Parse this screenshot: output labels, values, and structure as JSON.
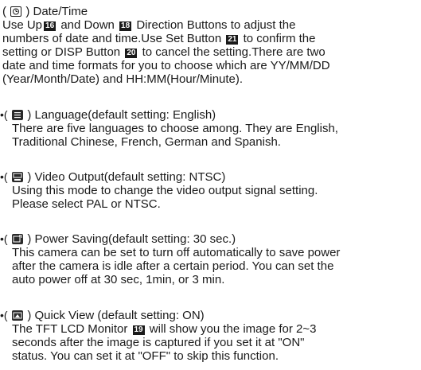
{
  "date_time": {
    "heading": ") Date/Time",
    "lines": [
      [
        "Use Up",
        "16",
        " and Down ",
        "18",
        " Direction Buttons to adjust the"
      ],
      [
        "numbers of date and time.Use Set Button ",
        "21",
        "  to confirm the"
      ],
      [
        "setting or DISP Button ",
        "20",
        " to cancel the setting.There are two"
      ],
      [
        "date and time formats for you to choose which are YY/MM/DD"
      ],
      [
        "(Year/Month/Date) and HH:MM(Hour/Minute)."
      ]
    ]
  },
  "language": {
    "heading": ") Language(default setting: English)",
    "lines": [
      "There are five languages to choose among. They are English,",
      "Traditional Chinese, French, German and  Spanish."
    ]
  },
  "video_output": {
    "heading": ") Video Output(default setting: NTSC)",
    "lines": [
      "Using this mode to change the video output signal setting.",
      "Please select PAL or NTSC."
    ]
  },
  "power_saving": {
    "heading": ") Power Saving(default setting: 30 sec.)",
    "lines": [
      "This camera can be set to turn off automatically to save power",
      "after the camera is idle after a certain period. You can set the",
      "auto power off at 30 sec, 1min, or 3 min."
    ]
  },
  "quick_view": {
    "heading": ") Quick View (default setting: ON)",
    "line1_a": "The TFT LCD Monitor ",
    "line1_badge": "19",
    "line1_b": " will show you the image for 2~3",
    "lines": [
      "seconds after the image is captured if you set it at \"ON\"",
      "status.  You can set it at \"OFF\" to skip this function."
    ]
  },
  "bullet": "•(",
  "open_paren": "("
}
